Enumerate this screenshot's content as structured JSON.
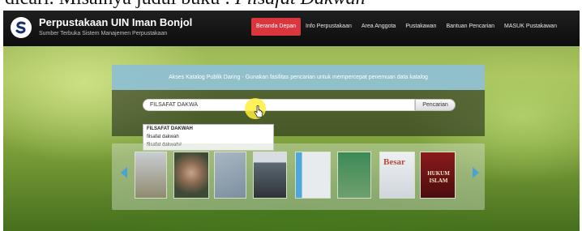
{
  "document_caption": {
    "prefix": "dicari. Misalnya judul buku : ",
    "emphasis": "Filsafat Dakwah"
  },
  "header": {
    "title": "Perpustakaan UIN Iman Bonjol",
    "subtitle": "Sumber Terbuka Sistem Manajemen Perpustakaan",
    "logo_letter": "S"
  },
  "nav": {
    "items": [
      {
        "label": "Beranda Depan",
        "active": true
      },
      {
        "label": "Info Perpustakaan",
        "active": false
      },
      {
        "label": "Area Anggota",
        "active": false
      },
      {
        "label": "Pustakawan",
        "active": false
      },
      {
        "label": "Bantuan Pencarian",
        "active": false
      },
      {
        "label": "MASUK Pustakawan",
        "active": false
      }
    ]
  },
  "search": {
    "hint": "Akses Katalog Publik Daring - Gunakan fasilitas pencarian untuk mempercepat penemuan data katalog",
    "value": "FILSAFAT DAKWA",
    "button_label": "Pencarian",
    "suggestions": [
      "FILSAFAT DAKWAH",
      "filsafat dakwah",
      "filsafat dakwah#"
    ]
  },
  "carousel": {
    "covers": [
      {
        "title": "",
        "color": "#c9cfd2"
      },
      {
        "title": "",
        "color": "#7d8f6a"
      },
      {
        "title": "",
        "color": "#b6a27c"
      },
      {
        "title": "",
        "color": "#7fa0b8"
      },
      {
        "title": "",
        "color": "#dfe3e6"
      },
      {
        "title": "",
        "color": "#4b9fd1"
      },
      {
        "title": "",
        "color": "#4f8d5c"
      },
      {
        "title": "Besar",
        "color": "#e4e6e8"
      },
      {
        "title": "HUKUM ISLAM",
        "color": "#7b1518"
      }
    ]
  },
  "colors": {
    "header_bg": "#141414",
    "nav_active": "#d9363e",
    "hint_bg": "#96c8d7",
    "cursor_halo": "#ffee3c"
  }
}
